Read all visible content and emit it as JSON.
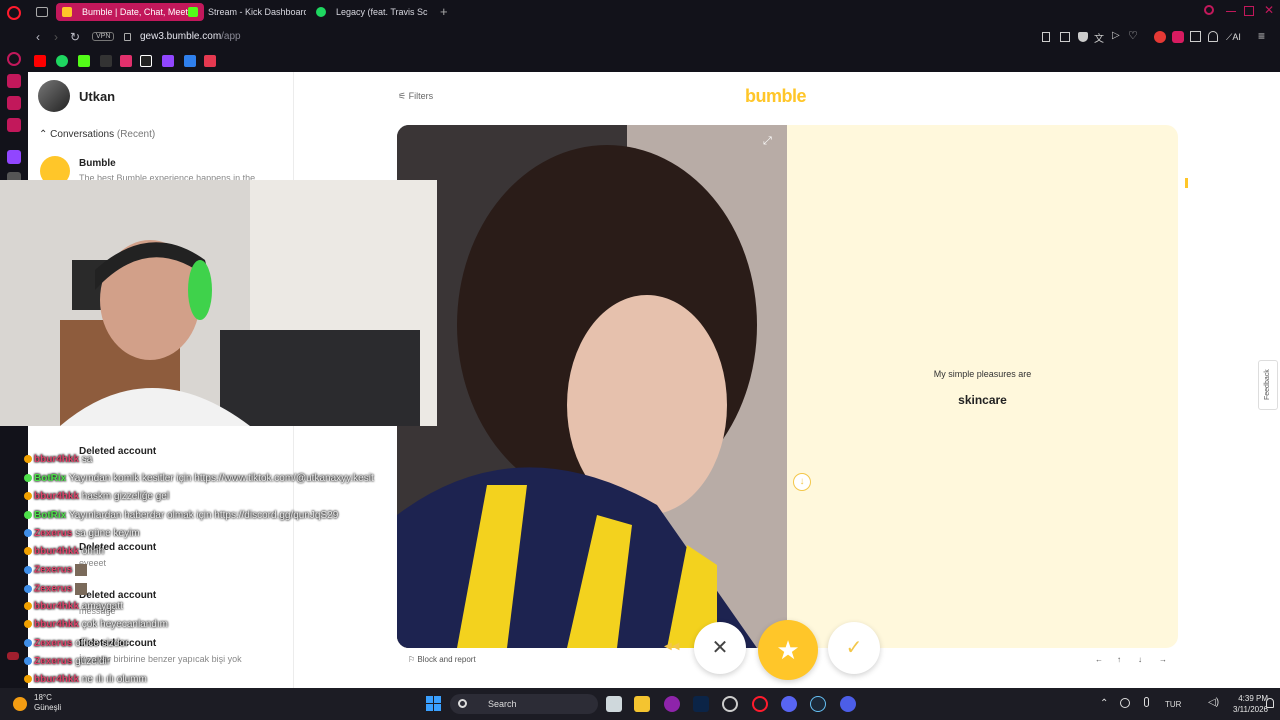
{
  "browser": {
    "tabs": [
      {
        "label": "Bumble | Date, Chat, Meet",
        "active": true,
        "icon": "bumble-icon"
      },
      {
        "label": "Stream - Kick Dashboard",
        "active": false,
        "icon": "kick-icon"
      },
      {
        "label": "Legacy (feat. Travis Sc",
        "active": false,
        "icon": "spotify-icon"
      }
    ],
    "url_host": "gew3.bumble.com",
    "url_path": "/app",
    "vpn_label": "VPN",
    "ai_label": "AI"
  },
  "sidebar": {
    "username": "Utkan",
    "conversations_label": "Conversations",
    "recent_label": "(Recent)",
    "bumble_chat": {
      "name": "Bumble",
      "snippet": "The best Bumble experience happens in the"
    },
    "deleted": [
      {
        "name": "Deleted account",
        "sub": ""
      },
      {
        "name": "Deleted account",
        "sub": "eyeeet"
      },
      {
        "name": "Deleted account",
        "sub": "message"
      },
      {
        "name": "Deleted account",
        "sub": "İnsanlar birbirine benzer yapıcak bişi yok"
      }
    ]
  },
  "main": {
    "filters_label": "Filters",
    "logo": "bumble",
    "pleasure_question": "My simple pleasures are",
    "pleasure_answer": "skincare",
    "feedback_label": "Feedback",
    "block_label": "Block and report",
    "pager": [
      "←",
      "↑",
      "↓",
      "→"
    ]
  },
  "chat": [
    {
      "user": "bbur4hkk",
      "color": "#e0436a",
      "msg": "sa"
    },
    {
      "user": "BotRix",
      "color": "#4ee14b",
      "msg": "Yayından komik kesitler için https://www.tiktok.com/@utkanaxyy.kesit"
    },
    {
      "user": "bbur4hkk",
      "color": "#e0436a",
      "msg": "haskm gizzeliğe gel"
    },
    {
      "user": "BotRix",
      "color": "#4ee14b",
      "msg": "Yayınlardan haberdar olmak için https://discord.gg/qunJqS29"
    },
    {
      "user": "Zexerus",
      "color": "#e0436a",
      "msg": "sa güne keyim"
    },
    {
      "user": "bbur4hkk",
      "color": "#e0436a",
      "msg": "ohhh"
    },
    {
      "user": "Zexerus",
      "color": "#e0436a",
      "msg": ""
    },
    {
      "user": "Zexerus",
      "color": "#e0436a",
      "msg": ""
    },
    {
      "user": "bbur4hkk",
      "color": "#e0436a",
      "msg": "amaygatt"
    },
    {
      "user": "bbur4hkk",
      "color": "#e0436a",
      "msg": "çok heyecanlandım"
    },
    {
      "user": "Zexerus",
      "color": "#e0436a",
      "msg": "office sizdor"
    },
    {
      "user": "Zexerus",
      "color": "#e0436a",
      "msg": "güzeldir"
    },
    {
      "user": "bbur4hkk",
      "color": "#e0436a",
      "msg": "ne ılı ılı olumm"
    }
  ],
  "taskbar": {
    "temp": "18°C",
    "location": "Güneşli",
    "search_label": "Search",
    "lang": "TUR",
    "time": "4:39 PM",
    "date": "3/11/2026"
  }
}
